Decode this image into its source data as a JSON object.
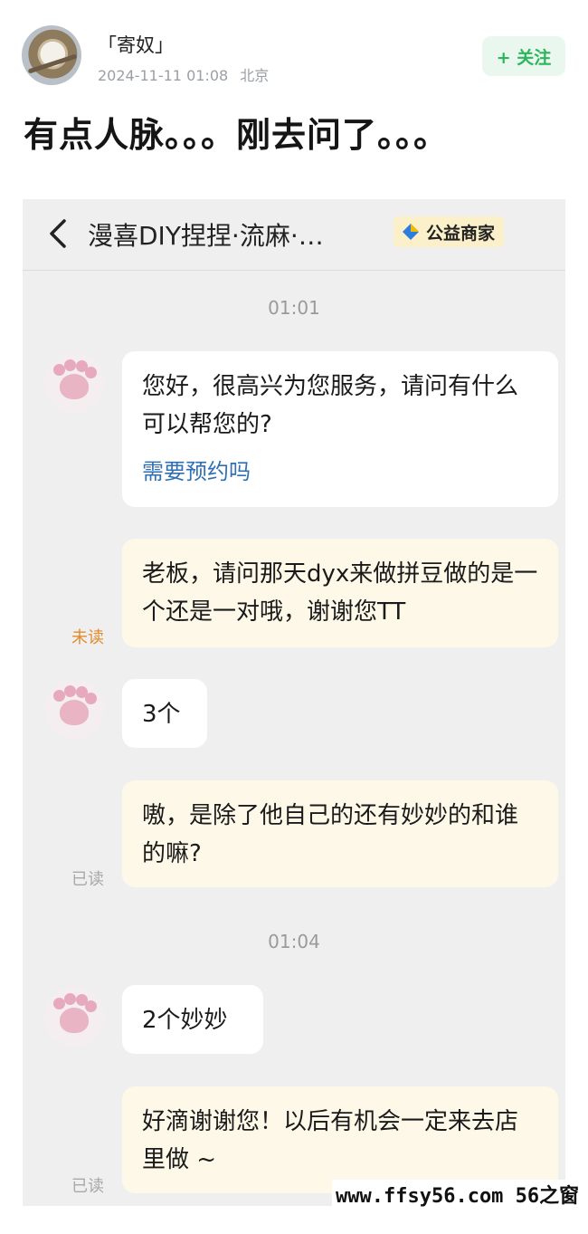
{
  "post": {
    "username": "「寄奴」",
    "timestamp": "2024-11-11 01:08",
    "location": "北京",
    "follow_label": "+ 关注",
    "title": "有点人脉。。。刚去问了。。。"
  },
  "chat": {
    "header": {
      "title": "漫喜DIY捏捏·流麻·…",
      "badge": "公益商家"
    },
    "timestamps": [
      "01:01",
      "01:04"
    ],
    "messages": [
      {
        "side": "in",
        "text": "您好，很高兴为您服务，请问有什么可以帮您的?",
        "link": "需要预约吗"
      },
      {
        "side": "out",
        "text": "老板，请问那天dyx来做拼豆做的是一个还是一对哦，谢谢您TT",
        "status": "未读"
      },
      {
        "side": "in",
        "text": "3个"
      },
      {
        "side": "out",
        "text": "嗷，是除了他自己的还有妙妙的和谁的嘛?",
        "status": "已读"
      },
      {
        "side": "in",
        "text": "2个妙妙"
      },
      {
        "side": "out",
        "text": "好滴谢谢您！以后有机会一定来去店里做 ~",
        "status": "已读"
      }
    ]
  },
  "watermark": "www.ffsy56.com 56之窗",
  "colors": {
    "follow_text": "#2db55d",
    "follow_bg": "#e9f7ee",
    "chat_bg": "#efefef",
    "bubble_out": "#fdf8e8",
    "link": "#2f6fb6",
    "unread": "#e38a2a",
    "read": "#a8a8a8"
  }
}
